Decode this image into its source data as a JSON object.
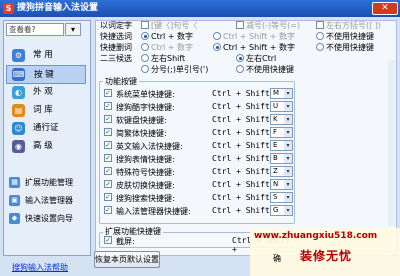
{
  "window": {
    "title": "搜狗拼音输入法设置",
    "app_icon_glyph": "S",
    "close_glyph": "✕"
  },
  "search": {
    "placeholder": "查看看?",
    "button_glyph": "▾"
  },
  "nav": [
    {
      "label": "常 用",
      "icon": "settings-icon",
      "glyph": "⚙",
      "color": "#3f7fd6",
      "active": false
    },
    {
      "label": "按 键",
      "icon": "keyboard-icon",
      "glyph": "⌨",
      "color": "#3a6fc4",
      "active": true
    },
    {
      "label": "外 观",
      "icon": "appearance-icon",
      "glyph": "◐",
      "color": "#3aa0d8",
      "active": false
    },
    {
      "label": "词 库",
      "icon": "dictionary-icon",
      "glyph": "▤",
      "color": "#e08a1e",
      "active": false
    },
    {
      "label": "通行证",
      "icon": "passport-icon",
      "glyph": "☺",
      "color": "#2e8ad0",
      "active": false
    },
    {
      "label": "高 级",
      "icon": "advanced-icon",
      "glyph": "◉",
      "color": "#5a5a9a",
      "active": false
    }
  ],
  "tools": [
    {
      "label": "扩展功能管理",
      "icon": "extension-icon",
      "glyph": "▦"
    },
    {
      "label": "输入法管理器",
      "icon": "ime-manager-icon",
      "glyph": "▣"
    },
    {
      "label": "快速设置向导",
      "icon": "wizard-icon",
      "glyph": "◆"
    }
  ],
  "help_link": "搜狗输入法帮助",
  "top_options": {
    "bracket_row": {
      "label": "以词定字",
      "opt1": "[键〈]句号〈",
      "opt2": "减号(-)等号(=)",
      "opt3": "左右方括号([ ])"
    },
    "quick_select": {
      "label": "快捷选词",
      "opt1": "Ctrl + 数字",
      "opt2": "Ctrl + Shift + 数字",
      "opt3": "不使用快捷键"
    },
    "quick_delete": {
      "label": "快捷删词",
      "opt1": "Ctrl + 数字",
      "opt2": "Ctrl + Shift + 数字",
      "opt3": "不使用快捷键"
    },
    "second_third": {
      "label": "二三候选",
      "opt1": "左右Shift",
      "opt2": "左右Ctrl",
      "opt3": "分号(;)单引号(')",
      "opt4": "不使用快捷键"
    }
  },
  "shortcut_group": {
    "title": "功能按键",
    "items": [
      {
        "name": "系统菜单快捷键:",
        "combo": "Ctrl + Shift +",
        "key": "M"
      },
      {
        "name": "搜狗酷字快捷键:",
        "combo": "Ctrl + Shift +",
        "key": "U"
      },
      {
        "name": "软键盘快捷键:",
        "combo": "Ctrl + Shift +",
        "key": "K"
      },
      {
        "name": "简繁体快捷键:",
        "combo": "Ctrl + Shift +",
        "key": "F"
      },
      {
        "name": "英文输入法快捷键:",
        "combo": "Ctrl + Shift +",
        "key": "E"
      },
      {
        "name": "搜狗表情快捷键:",
        "combo": "Ctrl + Shift +",
        "key": "B"
      },
      {
        "name": "特殊符号快捷键:",
        "combo": "Ctrl + Shift +",
        "key": "Z"
      },
      {
        "name": "皮肤切换快捷键:",
        "combo": "Ctrl + Shift +",
        "key": "N"
      },
      {
        "name": "搜狗搜索快捷键:",
        "combo": "Ctrl + Shift +",
        "key": "S"
      },
      {
        "name": "输入法管理器快捷键:",
        "combo": "Ctrl + Shift +",
        "key": "G"
      }
    ]
  },
  "extension_group": {
    "title": "扩展功能快捷键",
    "items": [
      {
        "name": "截屏:",
        "combo": "Ctrl + Shift +"
      }
    ]
  },
  "buttons": {
    "restore": "恢复本页默认设置",
    "ok": "确"
  },
  "watermark": {
    "url": "www.zhuangxiu518.com",
    "text": "装修无忧"
  },
  "dropdown_glyph": "▾",
  "check_glyph": "✓"
}
